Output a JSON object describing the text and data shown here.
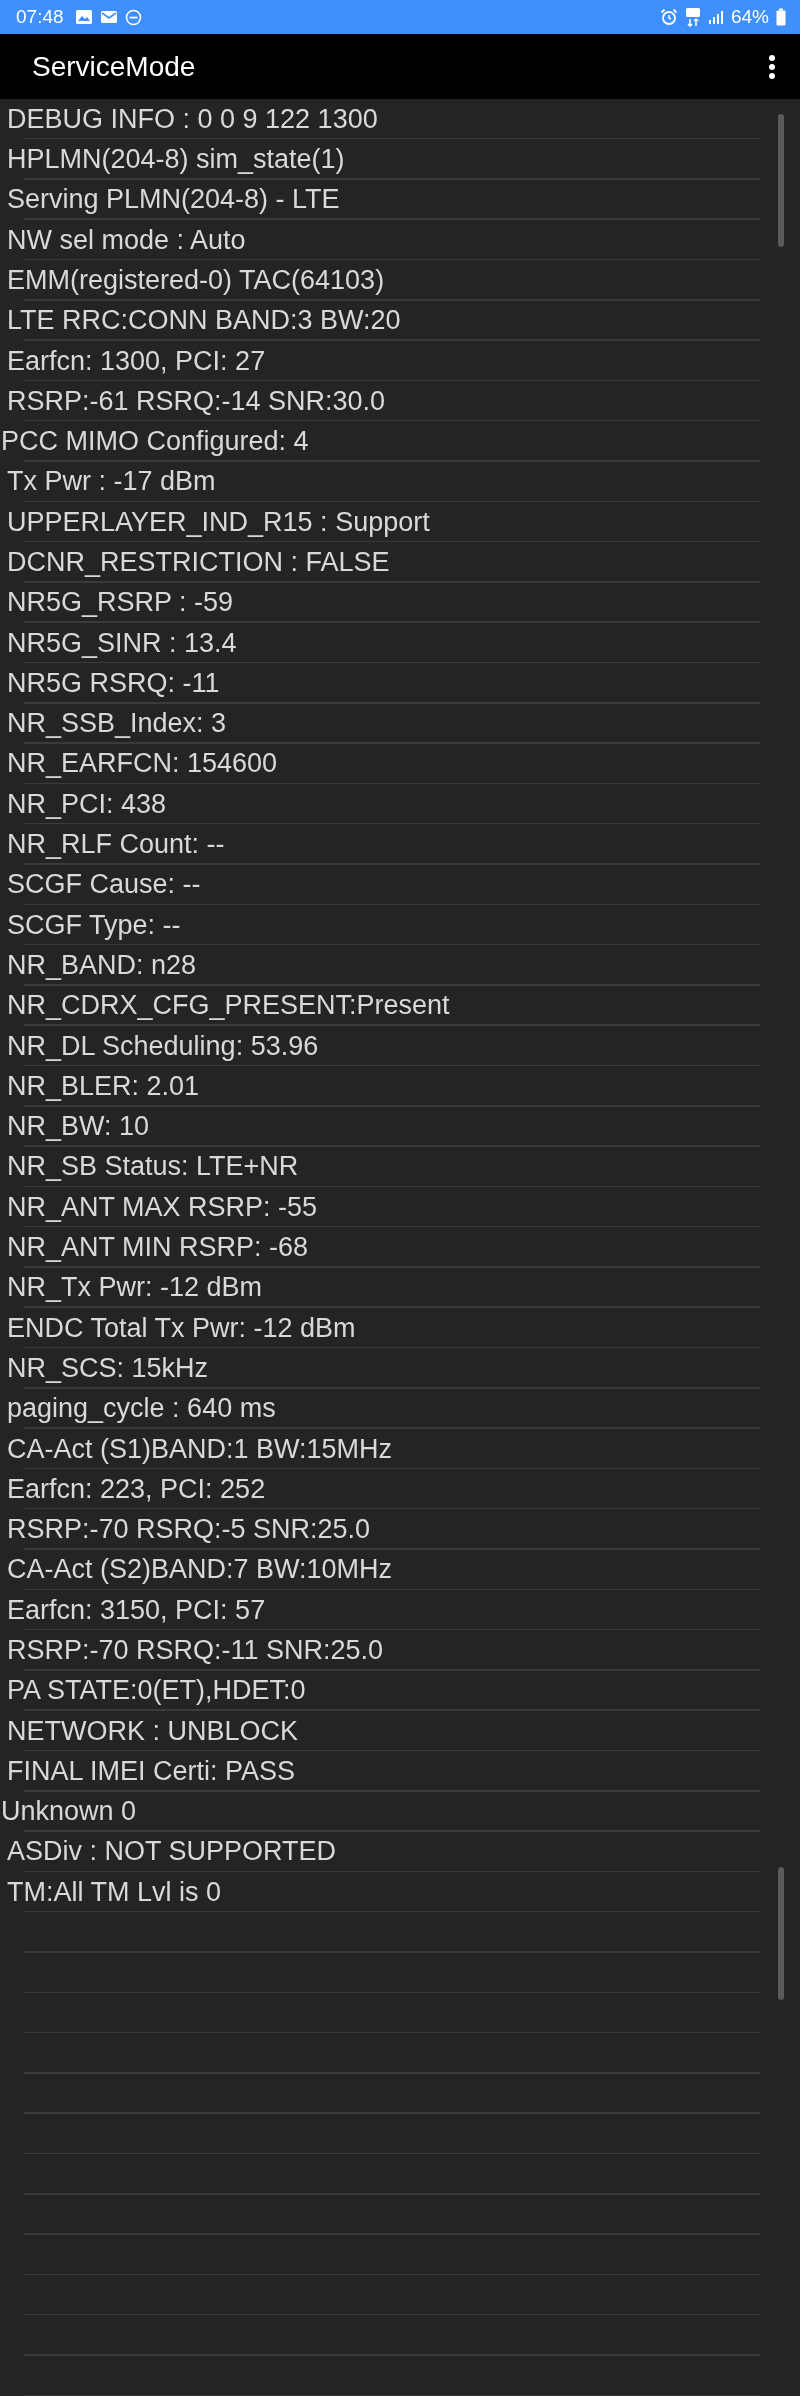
{
  "status_bar": {
    "time": "07:48",
    "battery": "64%"
  },
  "app_bar": {
    "title": "ServiceMode"
  },
  "rows": [
    {
      "text": "DEBUG INFO : 0 0 9 122 1300",
      "kind": "indented"
    },
    {
      "text": "HPLMN(204-8) sim_state(1)",
      "kind": "indented"
    },
    {
      "text": "Serving PLMN(204-8) - LTE",
      "kind": "indented"
    },
    {
      "text": "NW sel mode : Auto",
      "kind": "indented"
    },
    {
      "text": "EMM(registered-0) TAC(64103)",
      "kind": "indented"
    },
    {
      "text": "LTE RRC:CONN BAND:3 BW:20",
      "kind": "indented"
    },
    {
      "text": "Earfcn: 1300, PCI: 27",
      "kind": "indented"
    },
    {
      "text": "RSRP:-61 RSRQ:-14 SNR:30.0",
      "kind": "indented"
    },
    {
      "text": "PCC MIMO Configured: 4",
      "kind": "flush"
    },
    {
      "text": "Tx Pwr : -17 dBm",
      "kind": "indented"
    },
    {
      "text": "UPPERLAYER_IND_R15 : Support",
      "kind": "indented"
    },
    {
      "text": "DCNR_RESTRICTION : FALSE",
      "kind": "indented"
    },
    {
      "text": "NR5G_RSRP : -59",
      "kind": "indented"
    },
    {
      "text": "NR5G_SINR : 13.4",
      "kind": "indented"
    },
    {
      "text": "NR5G RSRQ: -11",
      "kind": "indented"
    },
    {
      "text": "NR_SSB_Index: 3",
      "kind": "indented"
    },
    {
      "text": "NR_EARFCN: 154600",
      "kind": "indented"
    },
    {
      "text": "NR_PCI: 438",
      "kind": "indented"
    },
    {
      "text": "NR_RLF Count: --",
      "kind": "indented"
    },
    {
      "text": "SCGF Cause: --",
      "kind": "indented"
    },
    {
      "text": "SCGF Type: --",
      "kind": "indented"
    },
    {
      "text": "NR_BAND: n28",
      "kind": "indented"
    },
    {
      "text": "NR_CDRX_CFG_PRESENT:Present",
      "kind": "indented"
    },
    {
      "text": "NR_DL Scheduling: 53.96",
      "kind": "indented"
    },
    {
      "text": "NR_BLER: 2.01",
      "kind": "indented"
    },
    {
      "text": "NR_BW: 10",
      "kind": "indented"
    },
    {
      "text": "NR_SB Status: LTE+NR",
      "kind": "indented"
    },
    {
      "text": "NR_ANT MAX RSRP: -55",
      "kind": "indented"
    },
    {
      "text": "NR_ANT MIN RSRP: -68",
      "kind": "indented"
    },
    {
      "text": "NR_Tx Pwr: -12 dBm",
      "kind": "indented"
    },
    {
      "text": "ENDC Total Tx Pwr: -12 dBm",
      "kind": "indented"
    },
    {
      "text": "NR_SCS: 15kHz",
      "kind": "indented"
    },
    {
      "text": "paging_cycle : 640 ms",
      "kind": "indented"
    },
    {
      "text": "CA-Act (S1)BAND:1 BW:15MHz",
      "kind": "indented"
    },
    {
      "text": "Earfcn: 223, PCI: 252",
      "kind": "indented"
    },
    {
      "text": "RSRP:-70 RSRQ:-5 SNR:25.0",
      "kind": "indented"
    },
    {
      "text": "CA-Act (S2)BAND:7 BW:10MHz",
      "kind": "indented"
    },
    {
      "text": "Earfcn: 3150, PCI: 57",
      "kind": "indented"
    },
    {
      "text": "RSRP:-70 RSRQ:-11 SNR:25.0",
      "kind": "indented"
    },
    {
      "text": "PA STATE:0(ET),HDET:0",
      "kind": "indented"
    },
    {
      "text": "NETWORK : UNBLOCK",
      "kind": "indented"
    },
    {
      "text": "FINAL IMEI Certi: PASS",
      "kind": "indented"
    },
    {
      "text": "Unknown 0",
      "kind": "flush"
    },
    {
      "text": "ASDiv : NOT SUPPORTED",
      "kind": "indented"
    },
    {
      "text": "TM:All TM Lvl is 0",
      "kind": "indented"
    }
  ]
}
